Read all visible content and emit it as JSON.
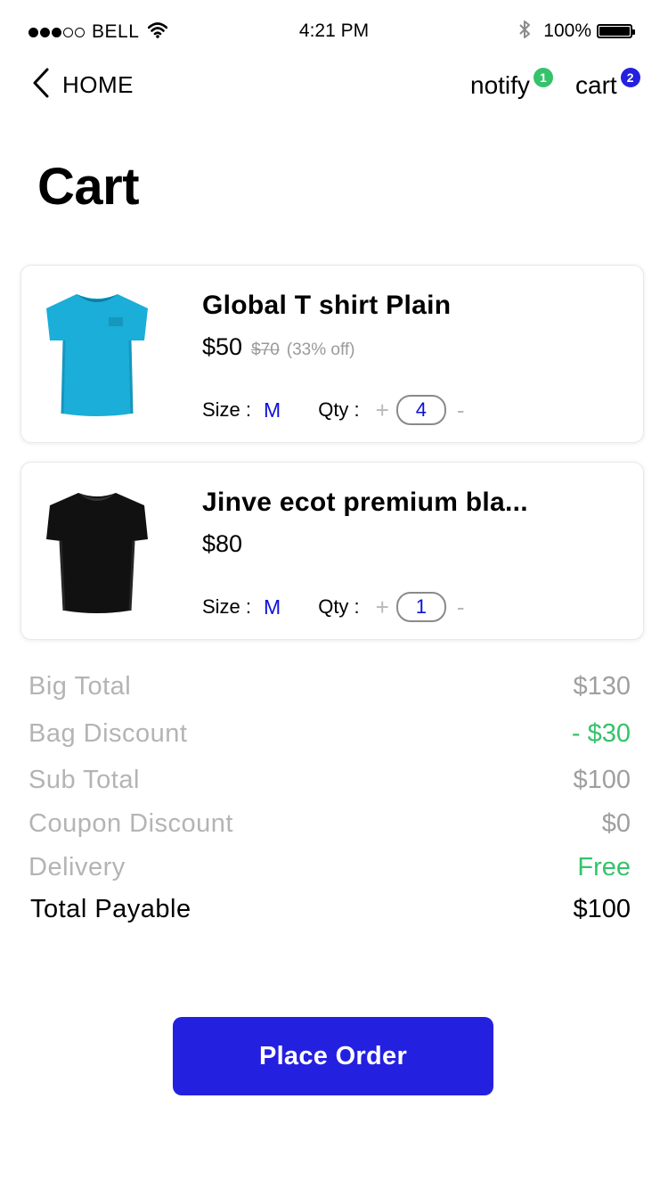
{
  "status_bar": {
    "carrier": "BELL",
    "time": "4:21 PM",
    "battery": "100%",
    "signal_bars": 3,
    "signal_total": 5
  },
  "nav": {
    "back_label": "HOME",
    "notify_label": "notify",
    "notify_count": "1",
    "cart_label": "cart",
    "cart_count": "2"
  },
  "page": {
    "title": "Cart"
  },
  "items": [
    {
      "name": "Global T shirt Plain",
      "price": "$50",
      "old_price": "$70",
      "discount": "(33% off)",
      "size_label": "Size :",
      "size": "M",
      "qty_label": "Qty :",
      "plus": "+",
      "qty": "4",
      "minus": "-",
      "color": "#1aaed8"
    },
    {
      "name": "Jinve ecot premium bla...",
      "price": "$80",
      "size_label": "Size :",
      "size": "M",
      "qty_label": "Qty :",
      "plus": "+",
      "qty": "1",
      "minus": "-",
      "color": "#111111"
    }
  ],
  "summary": {
    "big_total": {
      "label": "Big Total",
      "value": "$130"
    },
    "bag_discount": {
      "label": "Bag Discount",
      "value": "- $30"
    },
    "sub_total": {
      "label": "Sub Total",
      "value": "$100"
    },
    "coupon_discount": {
      "label": "Coupon Discount",
      "value": "$0"
    },
    "delivery": {
      "label": "Delivery",
      "value": "Free"
    },
    "total_payable": {
      "label": "Total Payable",
      "value": "$100"
    }
  },
  "actions": {
    "place_order": "Place Order"
  },
  "colors": {
    "accent": "#2420e0",
    "green": "#34c36a",
    "size_blue": "#0d11d6",
    "notify_badge": "#34c36a",
    "cart_badge": "#2420e0"
  },
  "icons": {
    "back": "chevron-left-icon",
    "wifi": "wifi-icon",
    "bluetooth": "bluetooth-icon",
    "battery": "battery-icon"
  }
}
